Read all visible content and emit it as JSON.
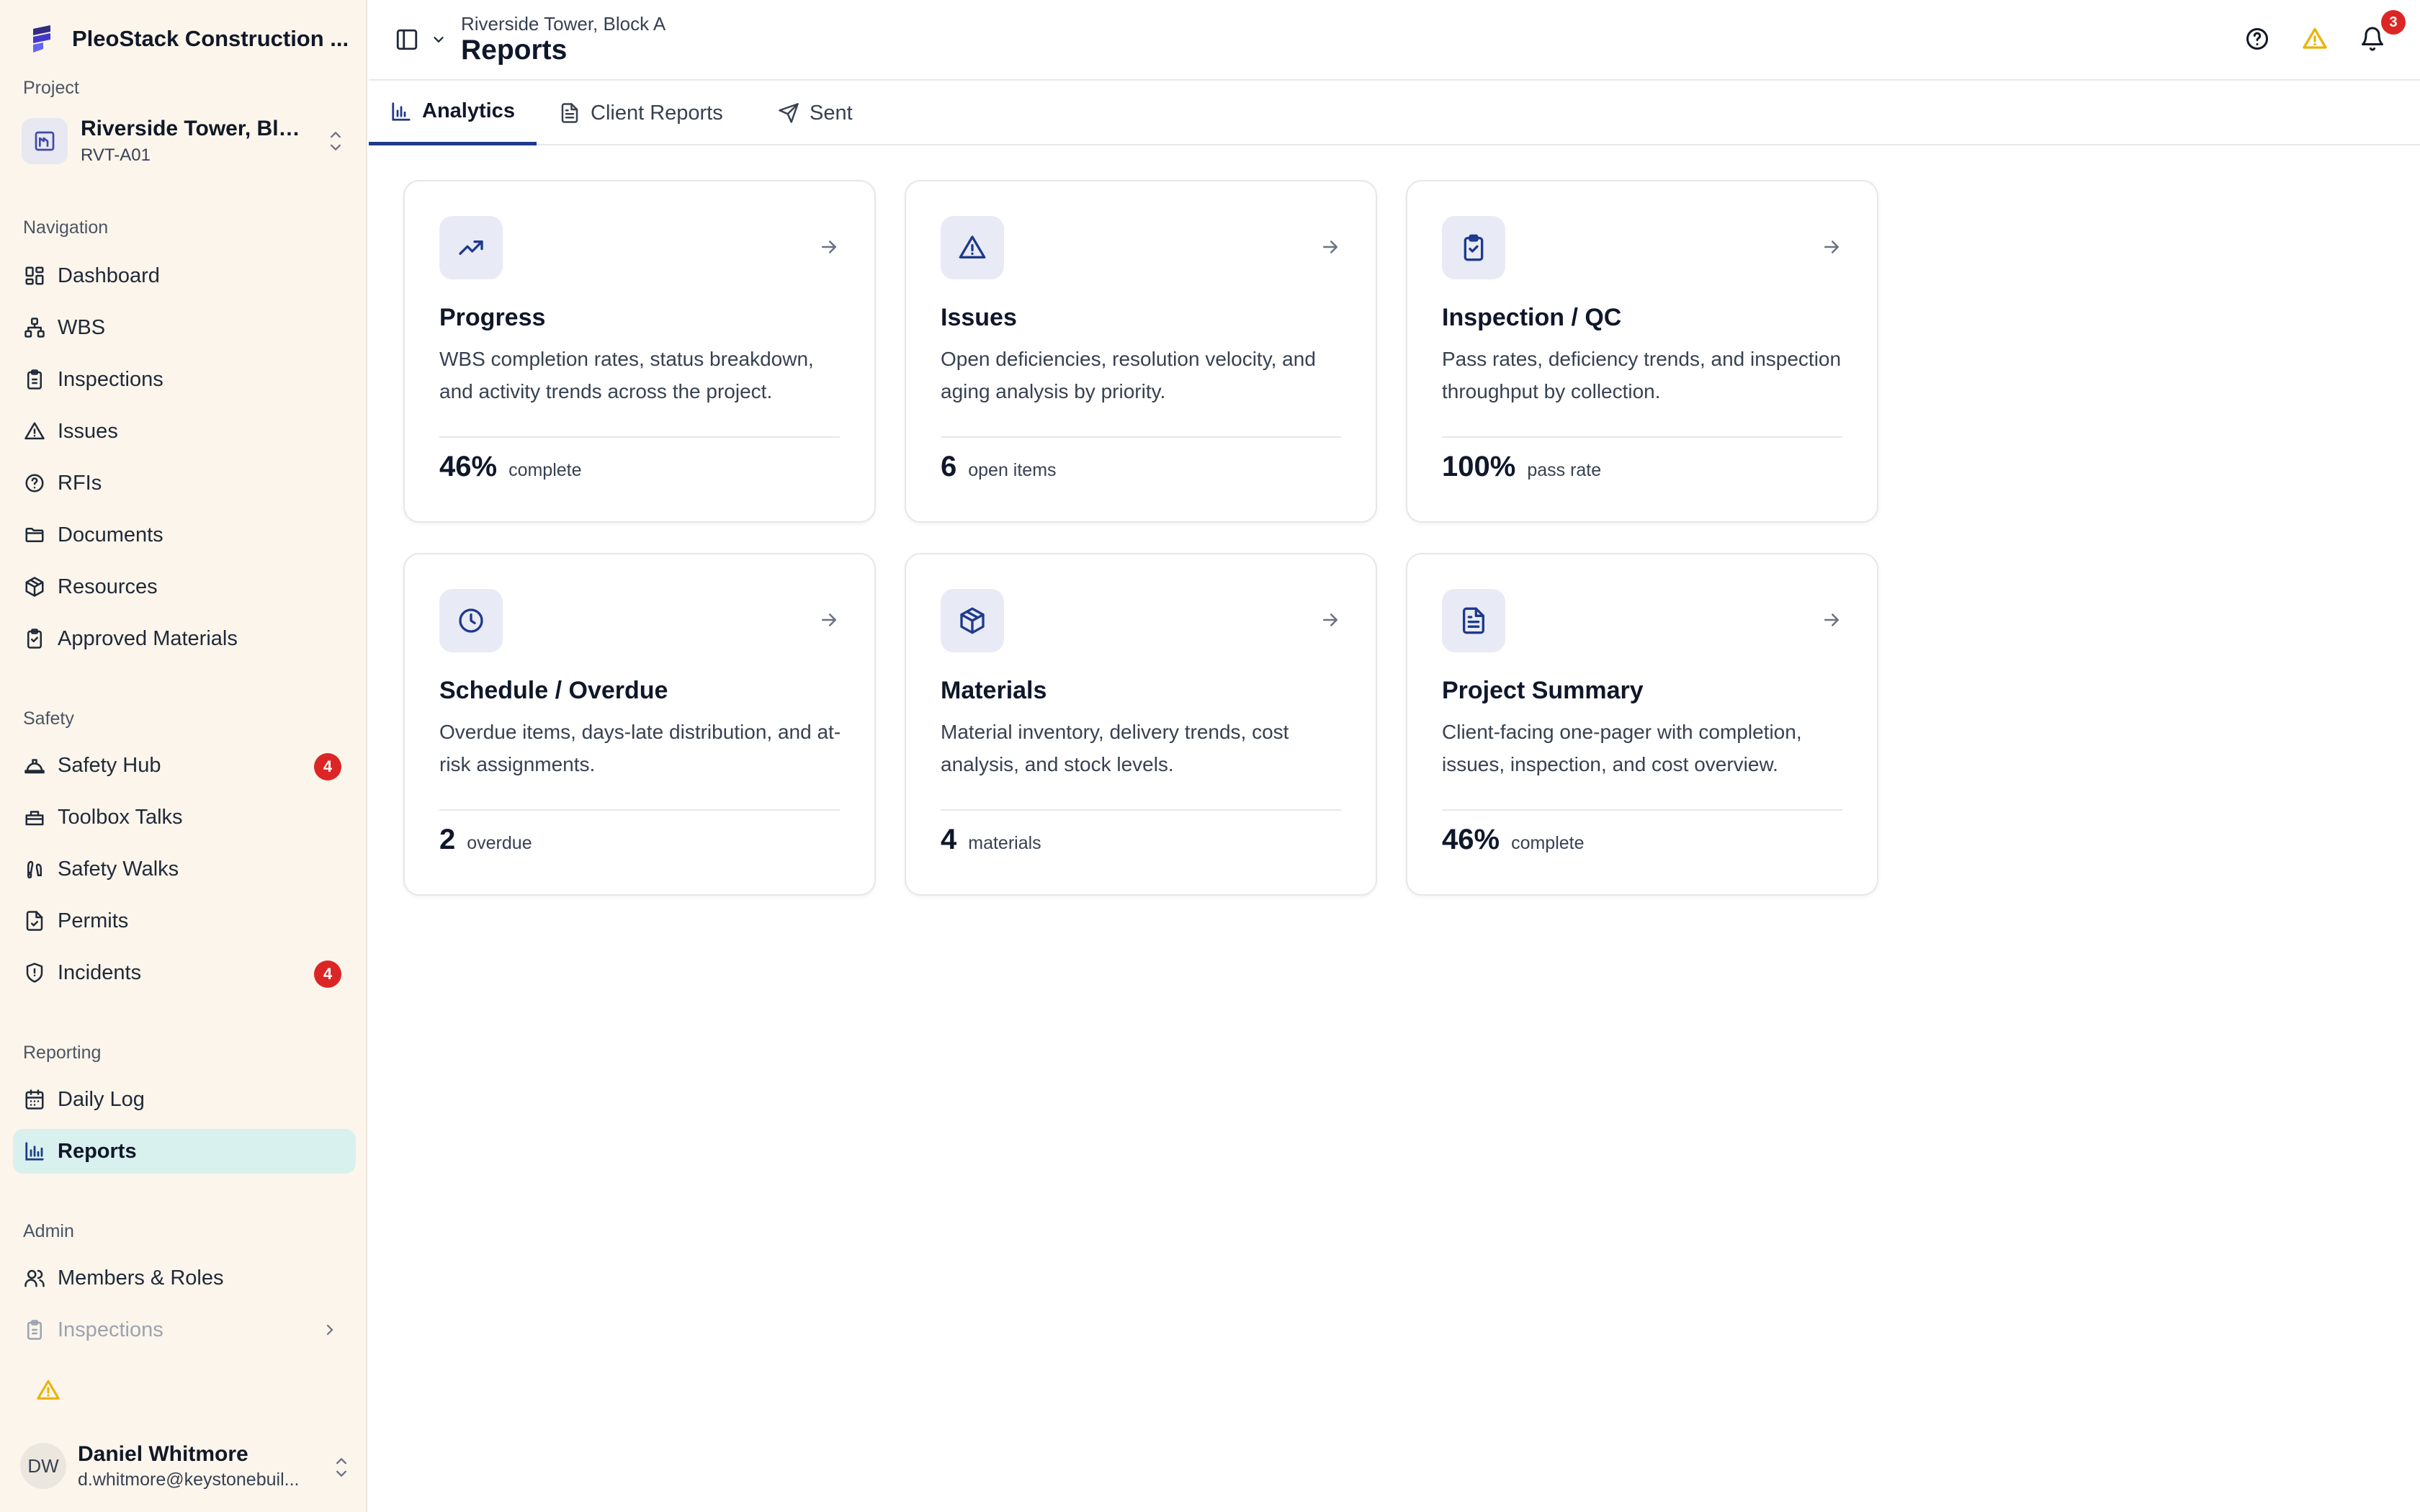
{
  "org": {
    "name": "PleoStack Construction ..."
  },
  "sidebar": {
    "project_label": "Project",
    "project": {
      "name": "Riverside Tower, Bloc...",
      "code": "RVT-A01"
    },
    "navigation_label": "Navigation",
    "navigation": [
      {
        "label": "Dashboard",
        "icon": "dashboard-icon"
      },
      {
        "label": "WBS",
        "icon": "network-icon"
      },
      {
        "label": "Inspections",
        "icon": "clipboard-icon"
      },
      {
        "label": "Issues",
        "icon": "warning-icon"
      },
      {
        "label": "RFIs",
        "icon": "question-icon"
      },
      {
        "label": "Documents",
        "icon": "folder-icon"
      },
      {
        "label": "Resources",
        "icon": "package-icon"
      },
      {
        "label": "Approved Materials",
        "icon": "clipboard-check-icon"
      }
    ],
    "safety_label": "Safety",
    "safety": [
      {
        "label": "Safety Hub",
        "icon": "hard-hat-icon",
        "badge": "4"
      },
      {
        "label": "Toolbox Talks",
        "icon": "toolbox-icon"
      },
      {
        "label": "Safety Walks",
        "icon": "footprints-icon"
      },
      {
        "label": "Permits",
        "icon": "file-check-icon"
      },
      {
        "label": "Incidents",
        "icon": "shield-icon",
        "badge": "4"
      }
    ],
    "reporting_label": "Reporting",
    "reporting": [
      {
        "label": "Daily Log",
        "icon": "calendar-icon"
      },
      {
        "label": "Reports",
        "icon": "bar-chart-icon",
        "active": true
      }
    ],
    "admin_label": "Admin",
    "admin": [
      {
        "label": "Members & Roles",
        "icon": "users-icon"
      },
      {
        "label": "Inspections",
        "icon": "clipboard-icon"
      }
    ],
    "user": {
      "initials": "DW",
      "name": "Daniel Whitmore",
      "email": "d.whitmore@keystonebuil..."
    }
  },
  "header": {
    "breadcrumb": "Riverside Tower, Block A",
    "title": "Reports",
    "notification_count": "3"
  },
  "tabs": [
    {
      "label": "Analytics",
      "icon": "bar-chart-icon",
      "active": true
    },
    {
      "label": "Client Reports",
      "icon": "file-text-icon"
    },
    {
      "label": "Sent",
      "icon": "send-icon"
    }
  ],
  "cards": [
    {
      "title": "Progress",
      "description": "WBS completion rates, status breakdown, and activity trends across the project.",
      "value": "46%",
      "unit": "complete",
      "icon": "trending-up-icon"
    },
    {
      "title": "Issues",
      "description": "Open deficiencies, resolution velocity, and aging analysis by priority.",
      "value": "6",
      "unit": "open items",
      "icon": "warning-icon"
    },
    {
      "title": "Inspection / QC",
      "description": "Pass rates, deficiency trends, and inspection throughput by collection.",
      "value": "100%",
      "unit": "pass rate",
      "icon": "clipboard-check-icon"
    },
    {
      "title": "Schedule / Overdue",
      "description": "Overdue items, days-late distribution, and at-risk assignments.",
      "value": "2",
      "unit": "overdue",
      "icon": "clock-icon"
    },
    {
      "title": "Materials",
      "description": "Material inventory, delivery trends, cost analysis, and stock levels.",
      "value": "4",
      "unit": "materials",
      "icon": "package-icon"
    },
    {
      "title": "Project Summary",
      "description": "Client-facing one-pager with completion, issues, inspection, and cost overview.",
      "value": "46%",
      "unit": "complete",
      "icon": "file-text-icon"
    }
  ],
  "colors": {
    "accent": "#1e3a8a",
    "active_bg": "#d8f1ee",
    "sidebar_bg": "#fcf5ec",
    "badge": "#dc2626",
    "warning": "#eab308"
  }
}
